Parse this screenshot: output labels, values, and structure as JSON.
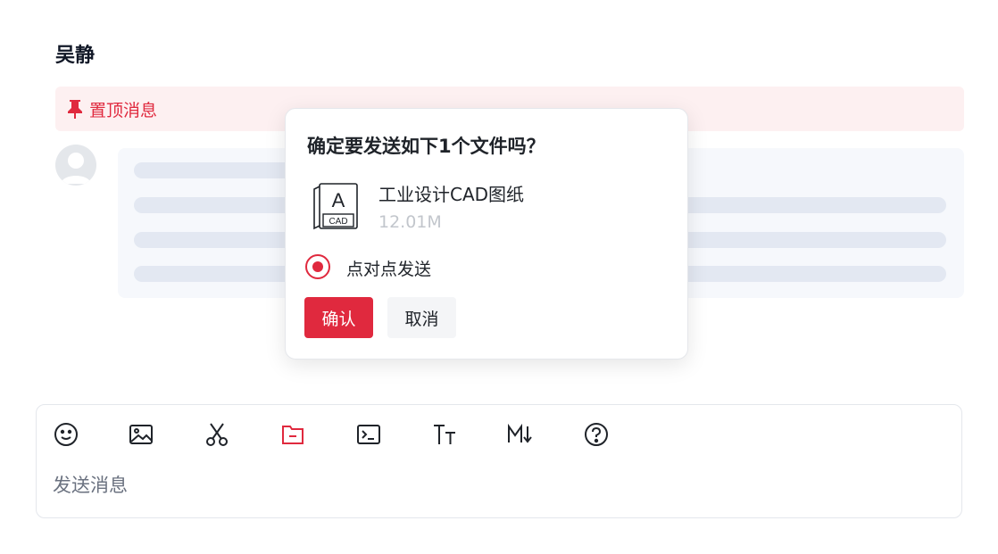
{
  "chat": {
    "title": "吴静",
    "pinned_label": "置顶消息"
  },
  "composer": {
    "placeholder": "发送消息",
    "toolbar": [
      {
        "icon": "emoji-icon",
        "active": false
      },
      {
        "icon": "image-icon",
        "active": false
      },
      {
        "icon": "scissors-icon",
        "active": false
      },
      {
        "icon": "folder-file-icon",
        "active": true
      },
      {
        "icon": "terminal-icon",
        "active": false
      },
      {
        "icon": "text-size-icon",
        "active": false
      },
      {
        "icon": "markdown-icon",
        "active": false
      },
      {
        "icon": "help-icon",
        "active": false
      }
    ]
  },
  "dialog": {
    "question": "确定要发送如下1个文件吗？",
    "file": {
      "name": "工业设计CAD图纸",
      "size": "12.01M",
      "icon_letter": "A",
      "icon_tag": "CAD"
    },
    "option_label": "点对点发送",
    "option_selected": true,
    "confirm_label": "确认",
    "cancel_label": "取消"
  },
  "colors": {
    "accent": "#e0293e",
    "pinned_bg": "#fdf0f1",
    "skeleton": "#e3e8f2"
  }
}
